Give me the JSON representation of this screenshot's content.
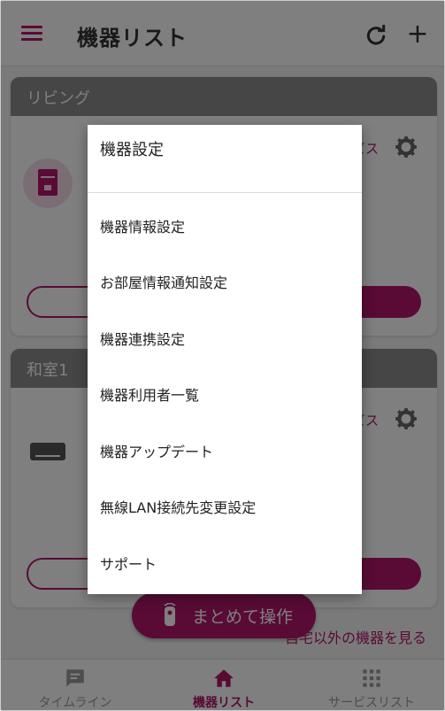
{
  "header": {
    "title": "機器リスト",
    "refresh_icon": "refresh-icon",
    "add_label": "+"
  },
  "rooms": [
    {
      "name": "リビング",
      "service_fragment": "ビス"
    },
    {
      "name": "和室1",
      "service_fragment": "ビス"
    }
  ],
  "fab": {
    "label": "まとめて操作",
    "icon": "remote-icon"
  },
  "other_link": "自宅以外の機器を見る",
  "bottom_nav": [
    {
      "label": "タイムライン",
      "icon": "chat-icon",
      "active": false
    },
    {
      "label": "機器リスト",
      "icon": "home-icon",
      "active": true
    },
    {
      "label": "サービスリスト",
      "icon": "grid-icon",
      "active": false
    }
  ],
  "dialog": {
    "title": "機器設定",
    "items": [
      "機器情報設定",
      "お部屋情報通知設定",
      "機器連携設定",
      "機器利用者一覧",
      "機器アップデート",
      "無線LAN接続先変更設定",
      "サポート"
    ]
  },
  "colors": {
    "accent": "#b3176b",
    "room_header": "#8c8c8c",
    "scrim": "rgba(0,0,0,0.5)"
  }
}
